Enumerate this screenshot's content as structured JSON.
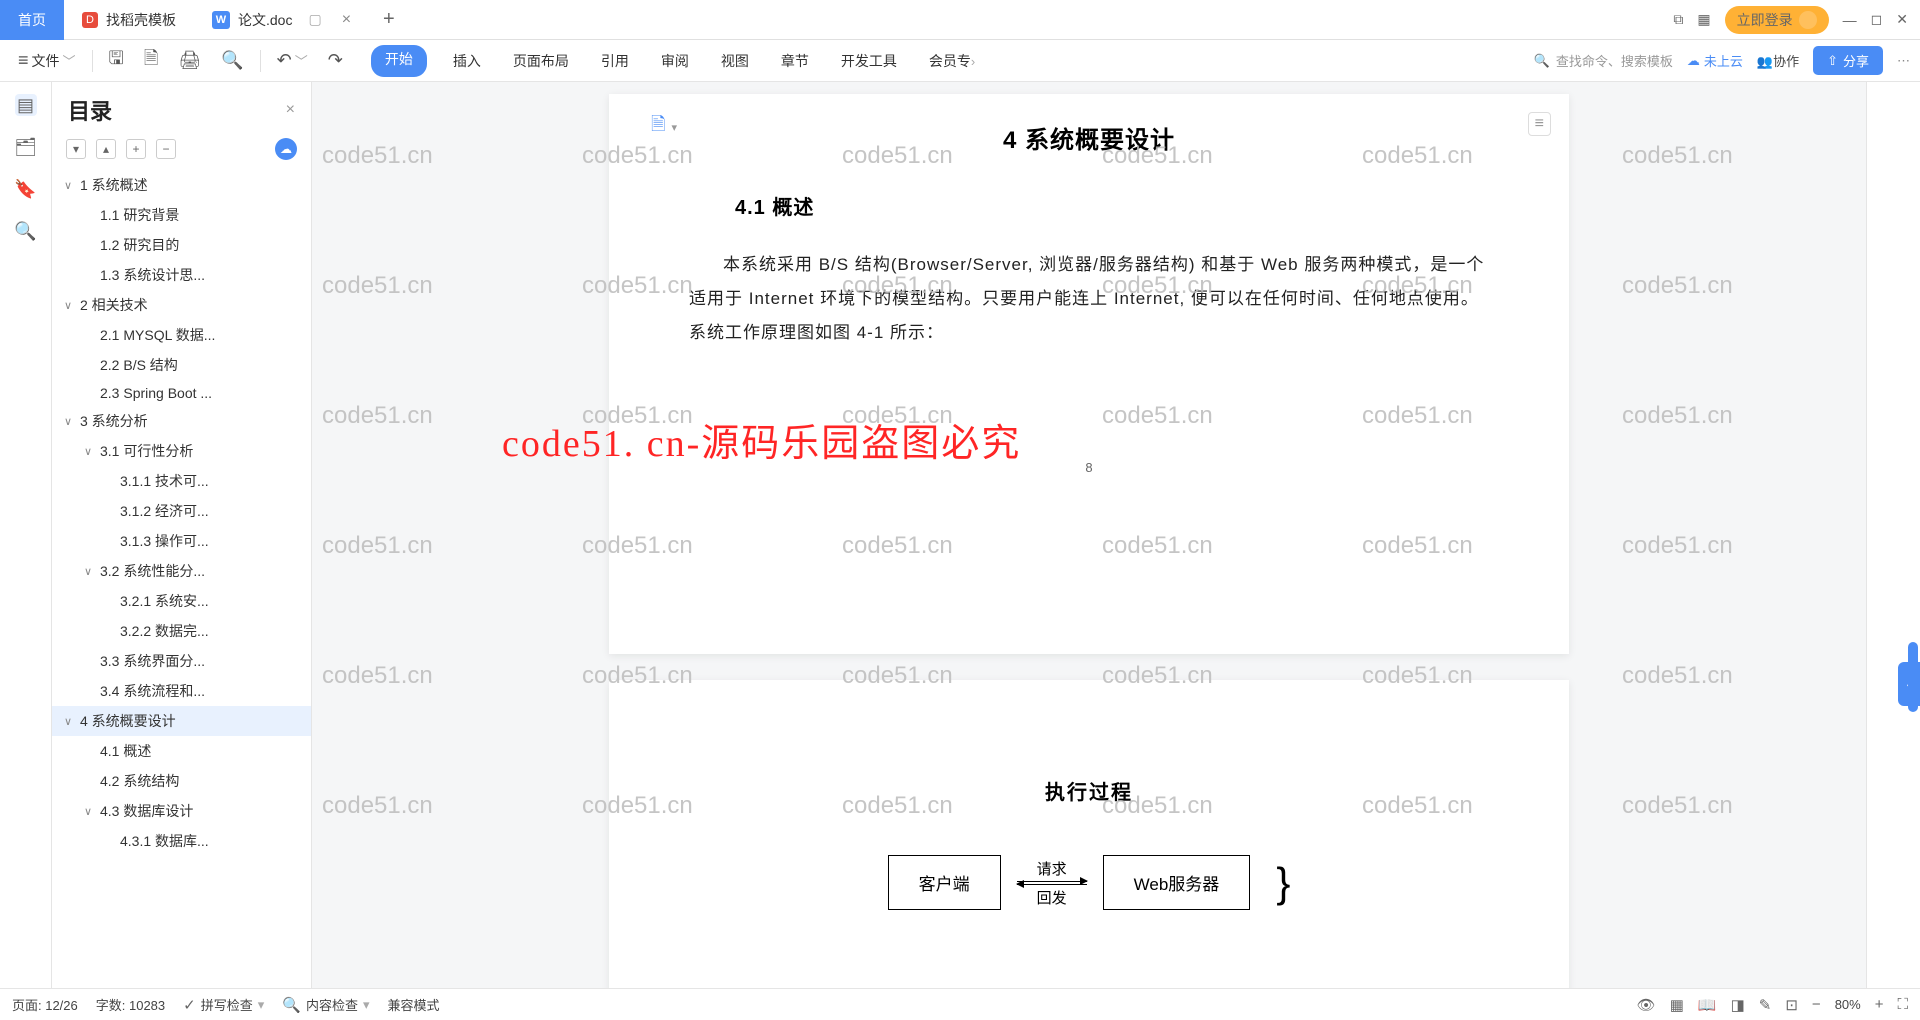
{
  "titlebar": {
    "home_tab": "首页",
    "template_tab": "找稻壳模板",
    "doc_tab": "论文.doc",
    "login_btn": "立即登录"
  },
  "toolbar": {
    "file_menu": "文件",
    "ribbon": {
      "start": "开始",
      "insert": "插入",
      "page_layout": "页面布局",
      "references": "引用",
      "review": "审阅",
      "view": "视图",
      "chapter": "章节",
      "dev_tools": "开发工具",
      "vip": "会员专"
    },
    "search_placeholder": "查找命令、搜索模板",
    "cloud_status": "未上云",
    "collab": "协作",
    "share": "分享"
  },
  "outline": {
    "title": "目录",
    "items": [
      {
        "lvl": 1,
        "chev": "∨",
        "text": "1 系统概述"
      },
      {
        "lvl": 2,
        "chev": "",
        "text": "1.1 研究背景"
      },
      {
        "lvl": 2,
        "chev": "",
        "text": "1.2 研究目的"
      },
      {
        "lvl": 2,
        "chev": "",
        "text": "1.3 系统设计思..."
      },
      {
        "lvl": 1,
        "chev": "∨",
        "text": "2 相关技术"
      },
      {
        "lvl": 2,
        "chev": "",
        "text": "2.1 MYSQL 数据..."
      },
      {
        "lvl": 2,
        "chev": "",
        "text": "2.2 B/S 结构"
      },
      {
        "lvl": 2,
        "chev": "",
        "text": "2.3 Spring Boot ..."
      },
      {
        "lvl": 1,
        "chev": "∨",
        "text": "3 系统分析"
      },
      {
        "lvl": 2,
        "chev": "∨",
        "text": "3.1 可行性分析"
      },
      {
        "lvl": 3,
        "chev": "",
        "text": "3.1.1 技术可..."
      },
      {
        "lvl": 3,
        "chev": "",
        "text": "3.1.2 经济可..."
      },
      {
        "lvl": 3,
        "chev": "",
        "text": "3.1.3 操作可..."
      },
      {
        "lvl": 2,
        "chev": "∨",
        "text": "3.2 系统性能分..."
      },
      {
        "lvl": 3,
        "chev": "",
        "text": "3.2.1 系统安..."
      },
      {
        "lvl": 3,
        "chev": "",
        "text": "3.2.2 数据完..."
      },
      {
        "lvl": 2,
        "chev": "",
        "text": "3.3 系统界面分..."
      },
      {
        "lvl": 2,
        "chev": "",
        "text": "3.4 系统流程和..."
      },
      {
        "lvl": 1,
        "chev": "∨",
        "text": "4 系统概要设计",
        "selected": true
      },
      {
        "lvl": 2,
        "chev": "",
        "text": "4.1 概述"
      },
      {
        "lvl": 2,
        "chev": "",
        "text": "4.2 系统结构"
      },
      {
        "lvl": 2,
        "chev": "∨",
        "text": "4.3 数据库设计"
      },
      {
        "lvl": 3,
        "chev": "",
        "text": "4.3.1 数据库..."
      }
    ]
  },
  "document": {
    "chapter_title": "4 系统概要设计",
    "section_title": "4.1 概述",
    "paragraph": "本系统采用 B/S 结构(Browser/Server, 浏览器/服务器结构) 和基于 Web 服务两种模式，是一个适用于 Internet 环境下的模型结构。只要用户能连上 Internet, 便可以在任何时间、任何地点使用。系统工作原理图如图 4-1 所示：",
    "page_number": "8",
    "diagram_title": "执行过程",
    "diagram": {
      "client": "客户端",
      "server": "Web服务器",
      "req": "请求",
      "resp": "回发"
    },
    "big_watermark": "code51. cn-源码乐园盗图必究",
    "watermark": "code51.cn"
  },
  "statusbar": {
    "page": "页面: 12/26",
    "words": "字数: 10283",
    "spellcheck": "拼写检查",
    "content_check": "内容检查",
    "compat_mode": "兼容模式",
    "zoom": "80%"
  }
}
